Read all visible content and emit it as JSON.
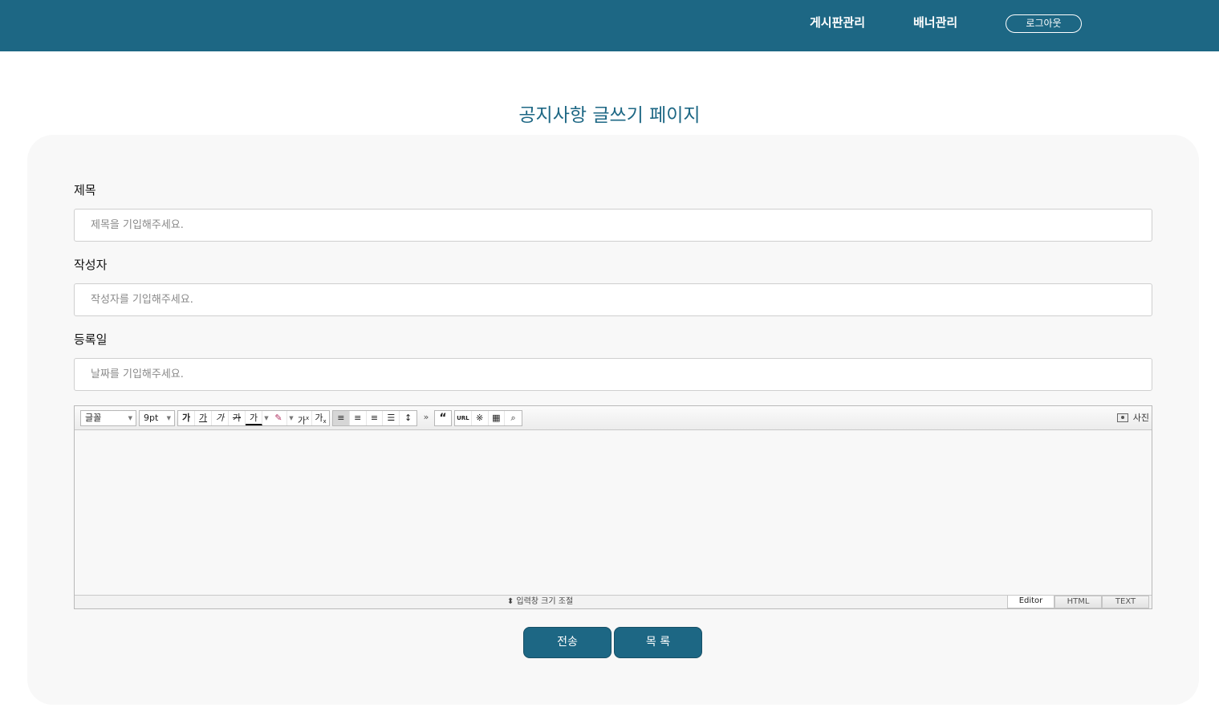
{
  "header": {
    "nav": [
      "게시판관리",
      "배너관리"
    ],
    "logout_label": "로그아웃",
    "bg_color": "#1d6784"
  },
  "page_title": "공지사항 글쓰기 페이지",
  "form": {
    "title_label": "제목",
    "title_placeholder": "제목을 기입해주세요.",
    "author_label": "작성자",
    "author_placeholder": "작성자를 기입해주세요.",
    "date_label": "등록일",
    "date_placeholder": "날짜를 기입해주세요."
  },
  "editor": {
    "font_select": "글꼴",
    "size_select": "9pt",
    "buttons": {
      "bold": "가",
      "underline": "가",
      "italic": "가",
      "strike": "가",
      "font_color": "가",
      "superscript": "가",
      "subscript": "가"
    },
    "quote": "“",
    "url": "URL",
    "photo_label": "사진",
    "resize_label": "입력창 크기 조절",
    "resize_arrow": "⬍",
    "tabs": [
      "Editor",
      "HTML",
      "TEXT"
    ]
  },
  "actions": {
    "submit_label": "전송",
    "list_label": "목 록"
  }
}
